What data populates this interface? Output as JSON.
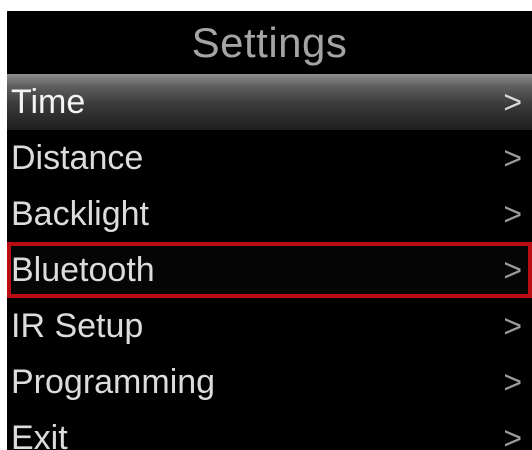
{
  "window": {
    "title": "Settings"
  },
  "menu": {
    "items": [
      {
        "label": "Time",
        "arrow": ">",
        "state": "highlighted"
      },
      {
        "label": "Distance",
        "arrow": ">",
        "state": "normal"
      },
      {
        "label": "Backlight",
        "arrow": ">",
        "state": "normal"
      },
      {
        "label": "Bluetooth",
        "arrow": ">",
        "state": "selected"
      },
      {
        "label": "IR Setup",
        "arrow": ">",
        "state": "normal"
      },
      {
        "label": "Programming",
        "arrow": ">",
        "state": "normal"
      },
      {
        "label": "Exit",
        "arrow": ">",
        "state": "normal"
      }
    ]
  },
  "colors": {
    "background": "#000000",
    "text": "#dcdcdc",
    "title_text": "#a4a4a4",
    "selection_outline": "#b80d12"
  }
}
